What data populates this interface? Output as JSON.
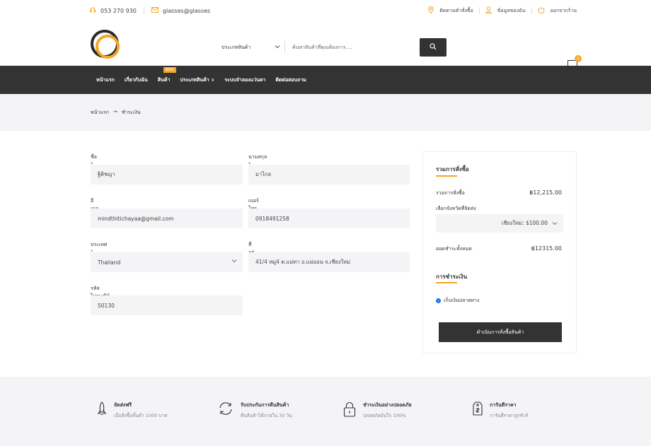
{
  "topbar": {
    "phone": "053 270 930",
    "email": "glasses@glasses",
    "track_order": "ติดตามคำสั่งซื้อ",
    "my_account": "ข้อมูลของฉัน",
    "logout": "ออกจากร้าน"
  },
  "search": {
    "category_label": "ประเภทสินค้า",
    "placeholder": "ค้นหาสินค้าที่คุณต้องการ...."
  },
  "cart": {
    "count": "0"
  },
  "nav": {
    "items": [
      "หน้าแรก",
      "เกี่ยวกับฉัน",
      "สินค้า",
      "ประเภทสินค้า",
      "ระบบจำลองแว่นตา",
      "ติดต่อสอบถาม"
    ],
    "new_badge": "NEW",
    "category_arrow": "∨"
  },
  "breadcrumb": {
    "home": "หน้าแรก",
    "arrow": "→",
    "current": "ชำระเงิน"
  },
  "form": {
    "first_name_label": "ชื่อ",
    "first_name_value": "ฐิติชญา",
    "last_name_label": "นามสกุล",
    "last_name_value": "มาไกล",
    "email_label": "อีเมลล์",
    "email_value": "mindthitichayaa@gmail.com",
    "phone_label": "เบอร์โทรติดต่อ",
    "phone_value": "0918491258",
    "country_label": "ประเทศ",
    "country_value": "Thailand",
    "address_label": "ที่อยู่",
    "address_value": "41/4 หมู่4 ต.แม่ทา อ.แม่ออน จ.เชียงใหม่",
    "postal_label": "รหัสไปรษณีย์",
    "postal_value": "50130",
    "required_mark": "*"
  },
  "summary": {
    "title": "รวมการสั่งซื้อ",
    "subtotal_label": "รวมการสั่งซื้อ",
    "subtotal_value": "฿12,215.00",
    "shipping_label": "เลือกจังหวัดที่จัดส่ง",
    "shipping_value": "เชียงใหม่: $100.00",
    "total_label": "ยอดชำระทั้งหมด",
    "total_value": "฿12315.00",
    "payment_title": "การชำระเงิน",
    "payment_option": "เก็บเงินปลายทาง",
    "place_order": "ดำเนินการสั่งซื้อสินค้า"
  },
  "features": [
    {
      "title": "จัดส่งฟรี",
      "sub": "เมื่อสั่งซื้อขั้นต่ำ 1000 บาท",
      "icon": "rocket-icon"
    },
    {
      "title": "รับประกันการคืนสินค้า",
      "sub": "คืนสินค้าได้ภายใน 30 วัน",
      "icon": "refresh-icon"
    },
    {
      "title": "ชำระเงินอย่างปลอดภัย",
      "sub": "ปลอดภัยมั่นใจ 100%",
      "icon": "lock-icon"
    },
    {
      "title": "การันตีราคา",
      "sub": "การันตีราคาถูกชัวร์",
      "icon": "price-tag-icon"
    }
  ]
}
